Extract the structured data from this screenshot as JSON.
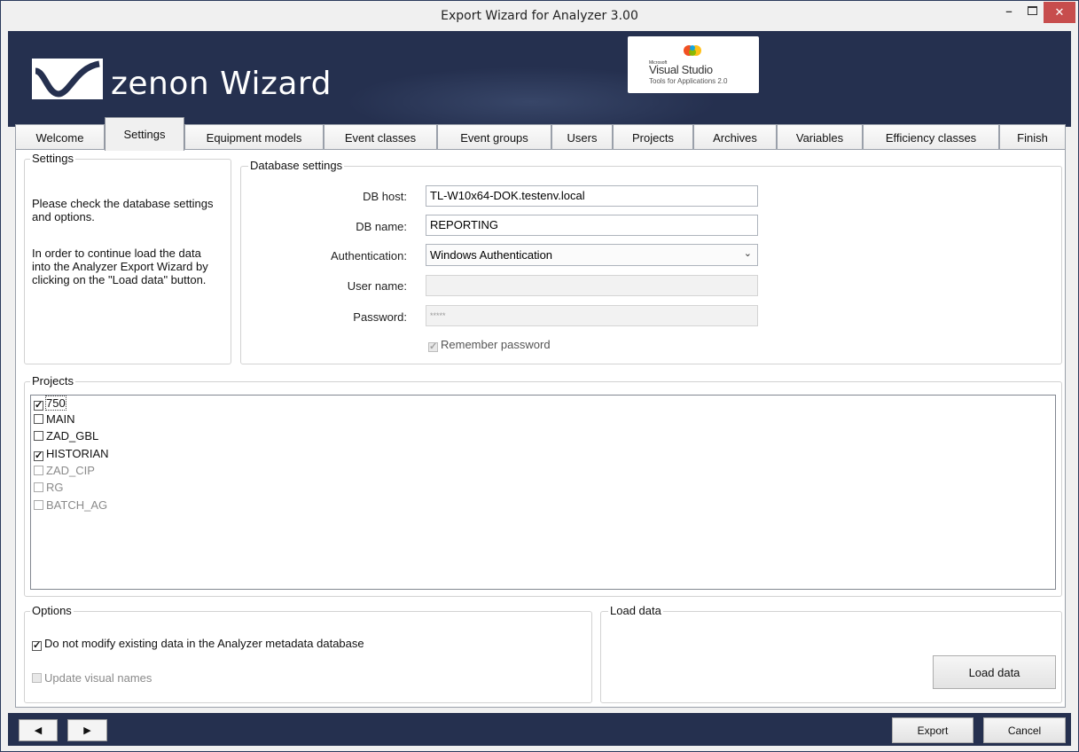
{
  "window": {
    "title": "Export Wizard for Analyzer 3.00"
  },
  "banner": {
    "logo_text": "zenon Wizard",
    "vs_badge": {
      "small": "Microsoft",
      "name": "Visual Studio",
      "sub": "Tools for Applications 2.0"
    }
  },
  "tabs": [
    {
      "label": "Welcome"
    },
    {
      "label": "Settings"
    },
    {
      "label": "Equipment models"
    },
    {
      "label": "Event classes"
    },
    {
      "label": "Event groups"
    },
    {
      "label": "Users"
    },
    {
      "label": "Projects"
    },
    {
      "label": "Archives"
    },
    {
      "label": "Variables"
    },
    {
      "label": "Efficiency classes"
    },
    {
      "label": "Finish"
    }
  ],
  "active_tab": "Settings",
  "settings_group": {
    "title": "Settings",
    "desc_1": "Please check the database settings and options.",
    "desc_2": "In order to continue load the data into the Analyzer Export Wizard by clicking on the \"Load data\" button."
  },
  "db_settings": {
    "title": "Database settings",
    "host_label": "DB host:",
    "host_value": "TL-W10x64-DOK.testenv.local",
    "name_label": "DB name:",
    "name_value": "REPORTING",
    "auth_label": "Authentication:",
    "auth_value": "Windows Authentication",
    "user_label": "User name:",
    "user_value": "",
    "pass_label": "Password:",
    "pass_value": "*****",
    "remember_label": "Remember password",
    "remember_checked": true
  },
  "projects": {
    "title": "Projects",
    "items": [
      {
        "label": "750",
        "checked": true
      },
      {
        "label": "MAIN",
        "checked": false
      },
      {
        "label": "ZAD_GBL",
        "checked": false
      },
      {
        "label": "HISTORIAN",
        "checked": true
      },
      {
        "label": "ZAD_CIP",
        "checked": false
      },
      {
        "label": "RG",
        "checked": false
      },
      {
        "label": "BATCH_AG",
        "checked": false
      }
    ]
  },
  "options": {
    "title": "Options",
    "no_modify_label": "Do not modify existing data in the Analyzer metadata database",
    "no_modify_checked": true,
    "update_names_label": "Update visual names",
    "update_names_checked": false
  },
  "load": {
    "title": "Load data",
    "button": "Load data"
  },
  "footer": {
    "export": "Export",
    "cancel": "Cancel"
  }
}
